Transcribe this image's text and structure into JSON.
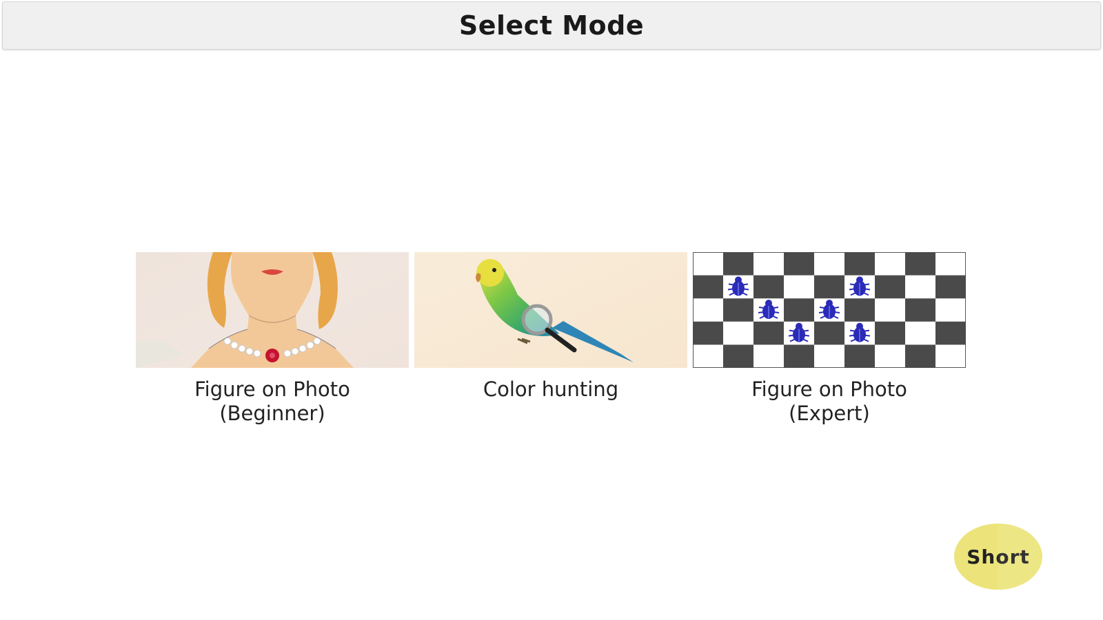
{
  "header": {
    "title": "Select Mode"
  },
  "modes": [
    {
      "line1": "Figure on Photo",
      "line2": "(Beginner)",
      "image": "woman-with-pearl-necklace-icon"
    },
    {
      "line1": "Color hunting",
      "line2": "",
      "image": "parrot-with-magnifier-icon"
    },
    {
      "line1": "Figure on Photo",
      "line2": "(Expert)",
      "image": "checkerboard-with-bugs-icon"
    }
  ],
  "short_button": {
    "label": "Short",
    "color": "#ece47a"
  },
  "colors": {
    "title_bar": "#f0f0f0",
    "checker_dark": "#4a4a4a",
    "bug": "#2b2bb8"
  }
}
